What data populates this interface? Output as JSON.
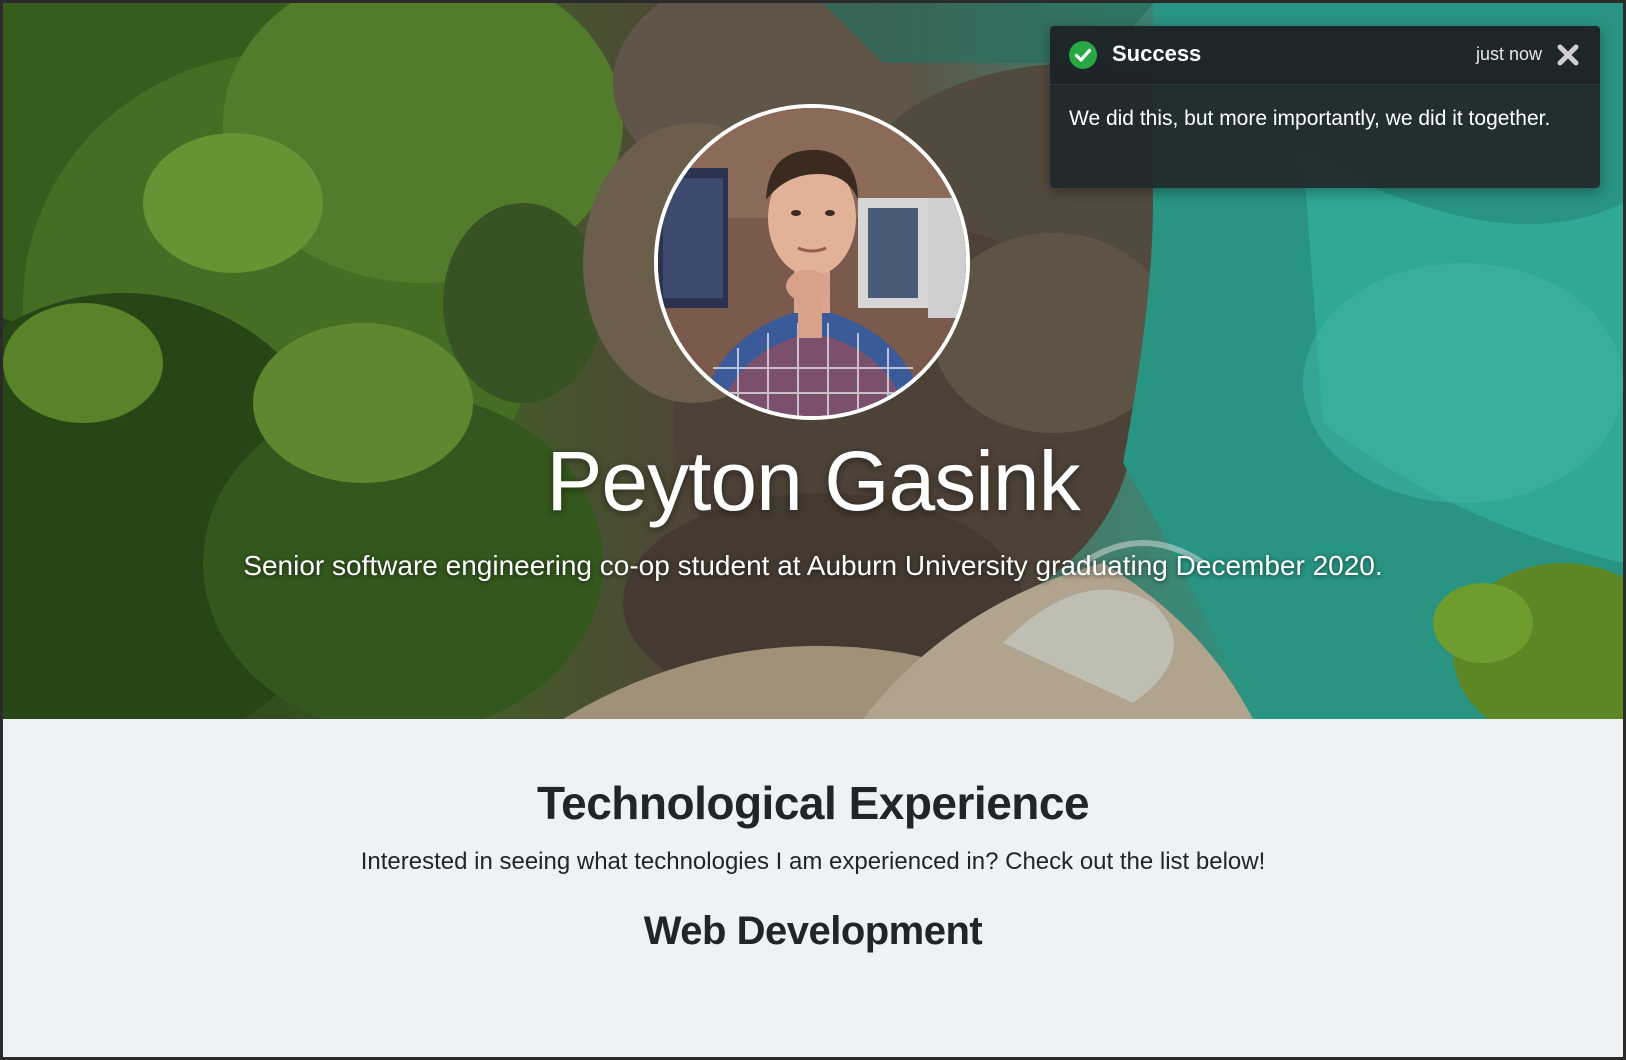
{
  "hero": {
    "name": "Peyton Gasink",
    "tagline": "Senior software engineering co-op student at Auburn University graduating December 2020."
  },
  "toast": {
    "title": "Success",
    "time": "just now",
    "message": "We did this, but more importantly, we did it together.",
    "status_color": "#28a745"
  },
  "content": {
    "section_title": "Technological Experience",
    "section_subtitle": "Interested in seeing what technologies I am experienced in? Check out the list below!",
    "subsection_title": "Web Development"
  }
}
